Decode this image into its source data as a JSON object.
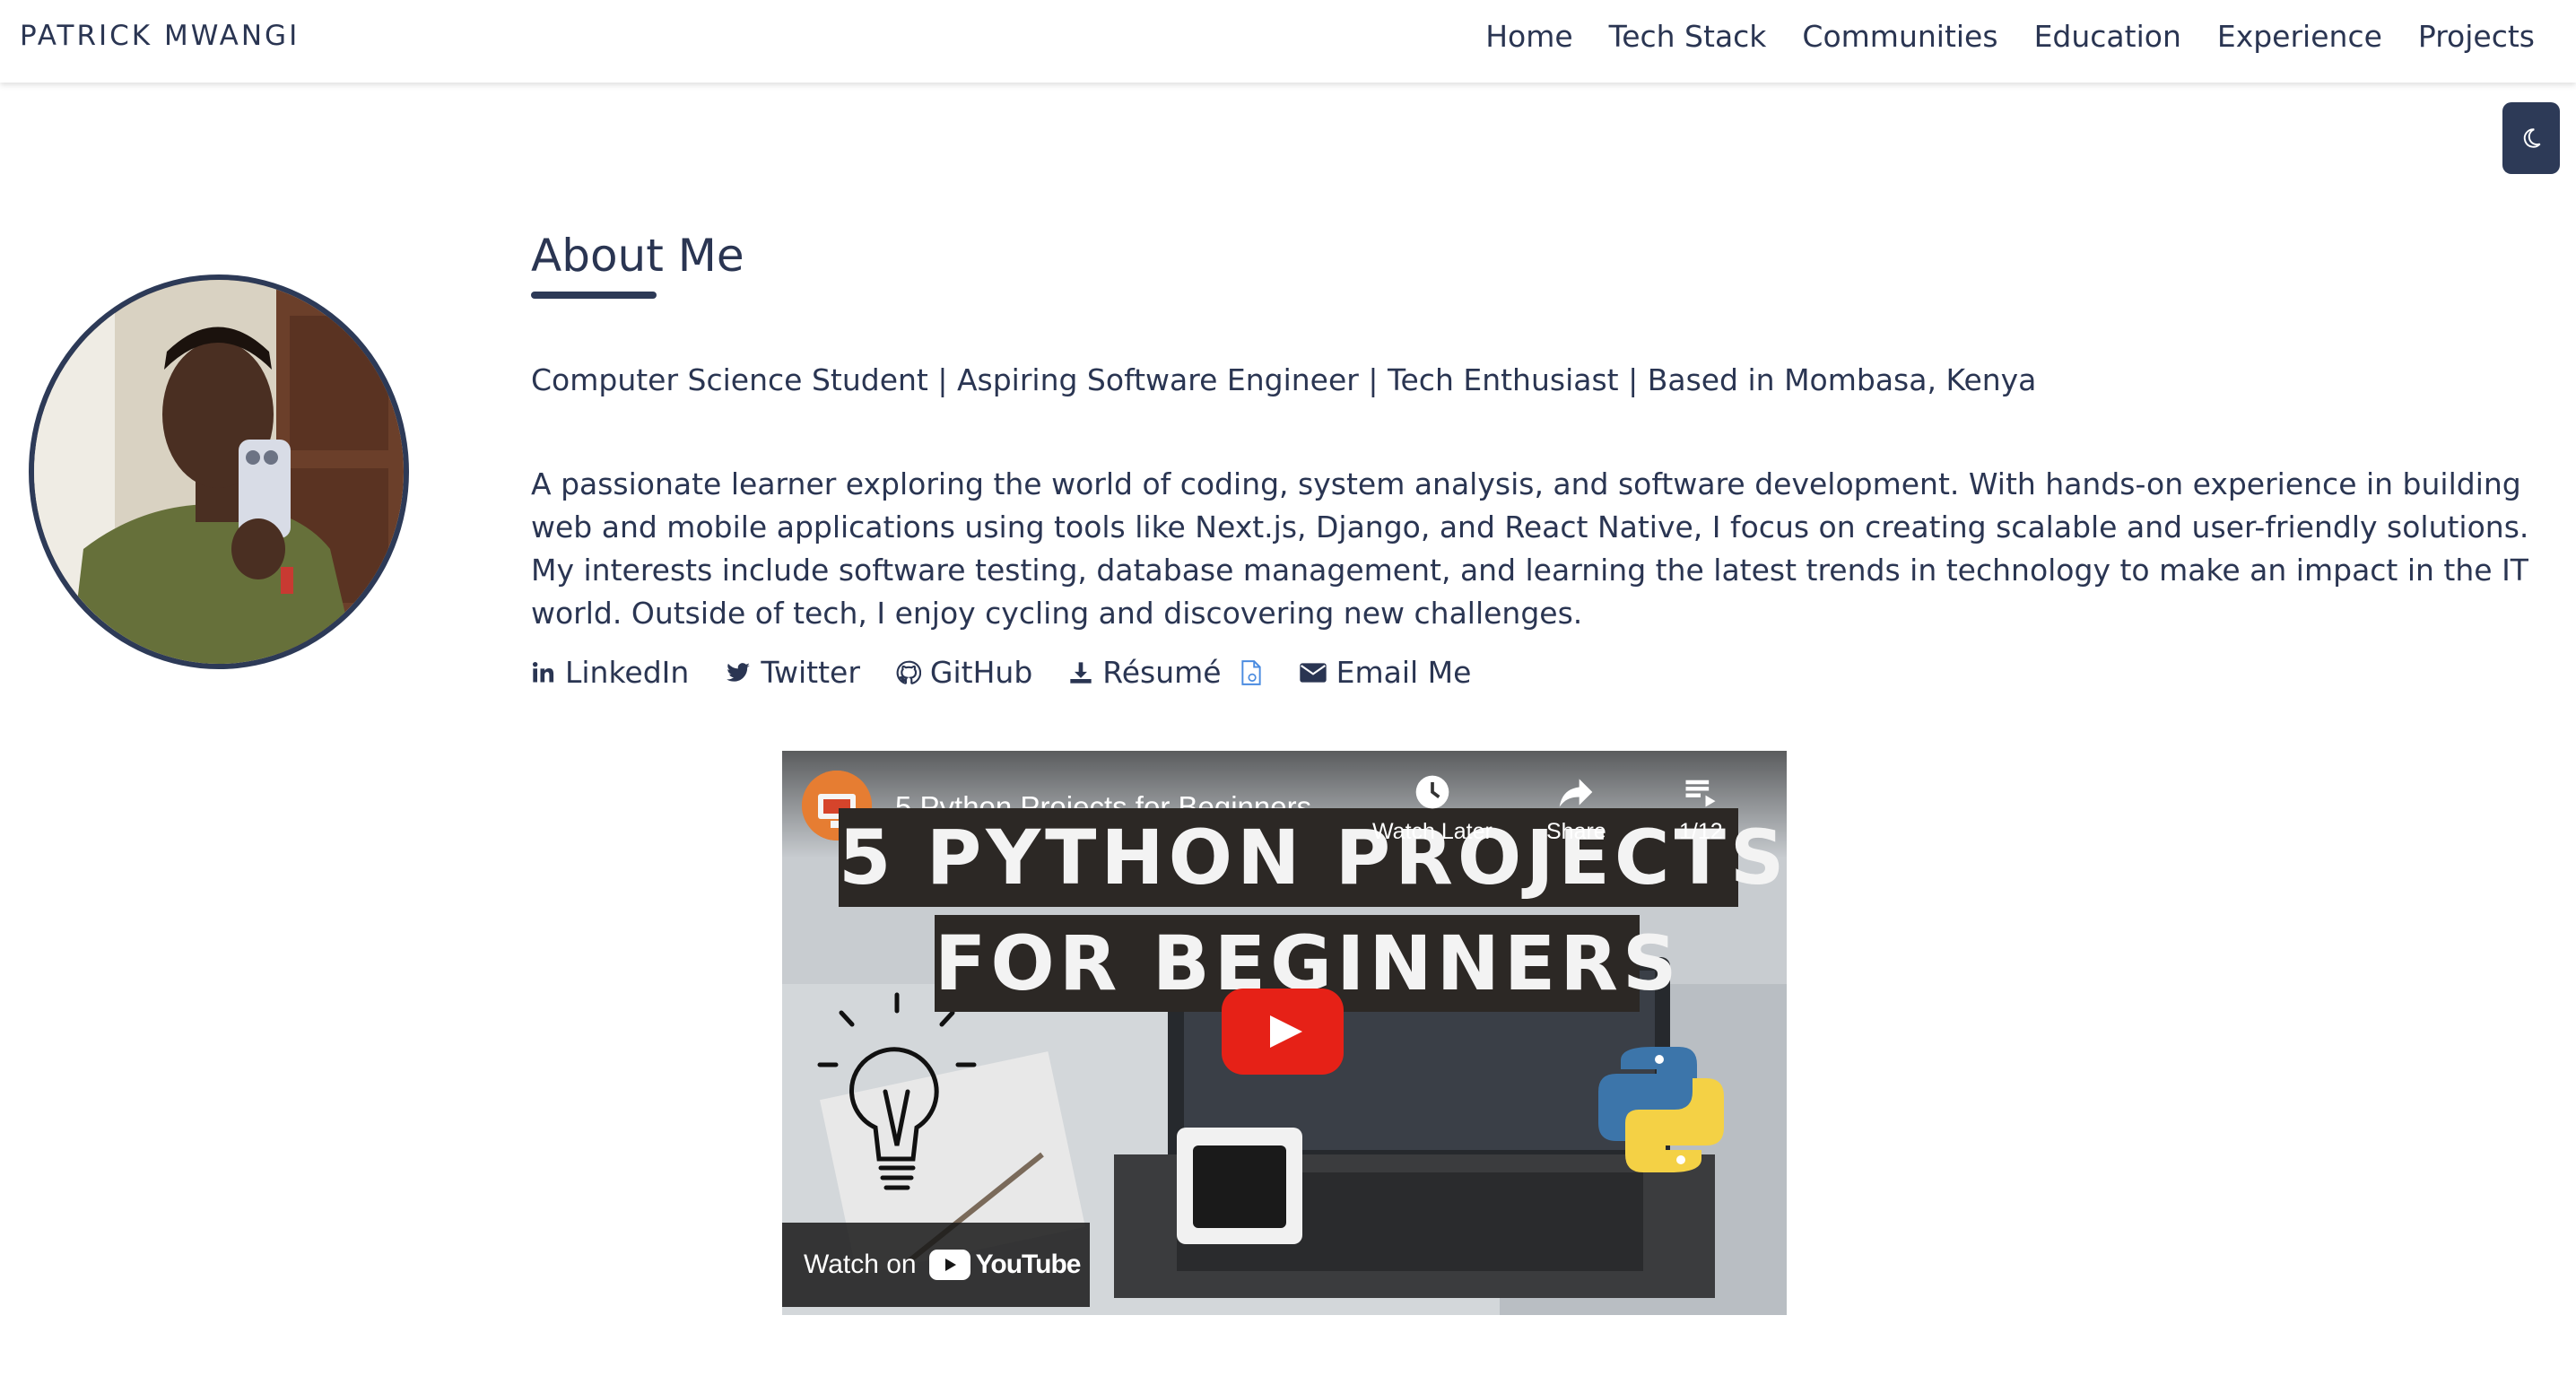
{
  "header": {
    "brand": "PATRICK MWANGI",
    "nav": [
      {
        "label": "Home"
      },
      {
        "label": "Tech Stack"
      },
      {
        "label": "Communities"
      },
      {
        "label": "Education"
      },
      {
        "label": "Experience"
      },
      {
        "label": "Projects"
      }
    ],
    "theme_toggle_icon": "moon-icon"
  },
  "about": {
    "title": "About Me",
    "tagline": "Computer Science Student | Aspiring Software Engineer | Tech Enthusiast | Based in Mombasa, Kenya",
    "bio": "A passionate learner exploring the world of coding, system analysis, and software development. With hands-on experience in building web and mobile applications using tools like Next.js, Django, and React Native, I focus on creating scalable and user-friendly solutions. My interests include software testing, database management, and learning the latest trends in technology to make an impact in the IT world. Outside of tech, I enjoy cycling and discovering new challenges.",
    "links": [
      {
        "label": "LinkedIn",
        "icon": "linkedin-icon"
      },
      {
        "label": "Twitter",
        "icon": "twitter-icon"
      },
      {
        "label": "GitHub",
        "icon": "github-icon"
      },
      {
        "label": "Résumé",
        "icon": "download-icon",
        "extra_icon": "document-icon"
      },
      {
        "label": "Email Me",
        "icon": "envelope-icon"
      }
    ]
  },
  "video": {
    "title": "5 Python Projects for Beginners",
    "thumbnail_line1": "5 PYTHON PROJECTS",
    "thumbnail_line2": "FOR BEGINNERS",
    "watch_later": "Watch Later",
    "share": "Share",
    "playlist_count": "1/12",
    "watch_on": "Watch on",
    "youtube": "YouTube"
  },
  "colors": {
    "primary": "#2d3a57",
    "text": "#2a3552",
    "youtube_red": "#e62117"
  }
}
